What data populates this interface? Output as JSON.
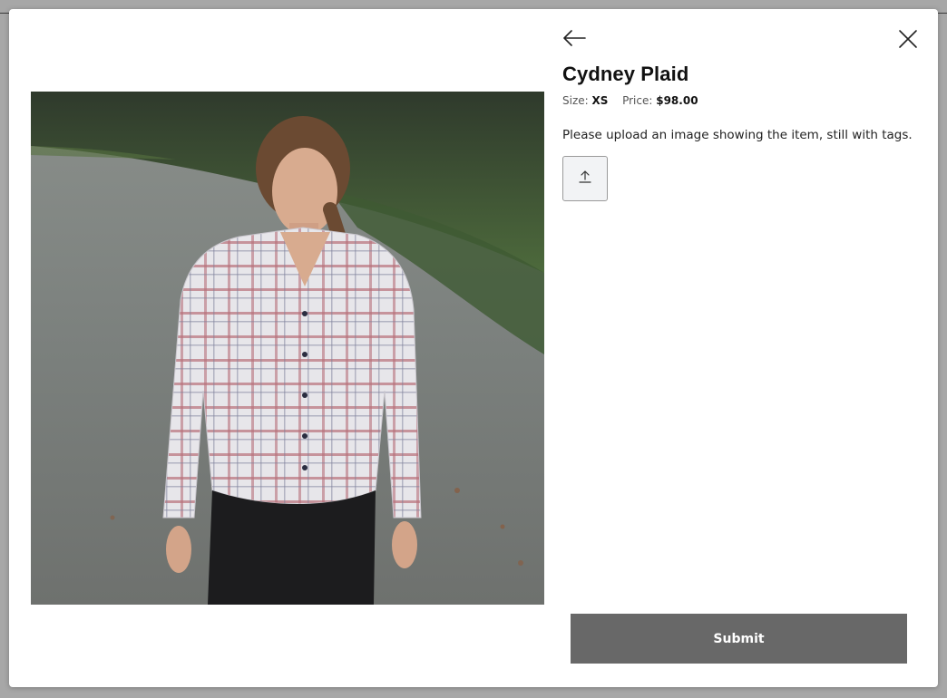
{
  "product": {
    "name": "Cydney Plaid",
    "size_label": "Size:",
    "size_value": "XS",
    "price_label": "Price:",
    "price_value": "$98.00",
    "photo_alt": "product-photo"
  },
  "upload": {
    "instruction": "Please upload an image showing the item, still with tags.",
    "icon": "upload-icon"
  },
  "actions": {
    "back_icon": "back-arrow-icon",
    "close_icon": "close-icon",
    "submit_label": "Submit"
  },
  "colors": {
    "submit_bg": "#686868",
    "backdrop": "#a7a7a7",
    "upload_bg": "#f2f3f5"
  }
}
